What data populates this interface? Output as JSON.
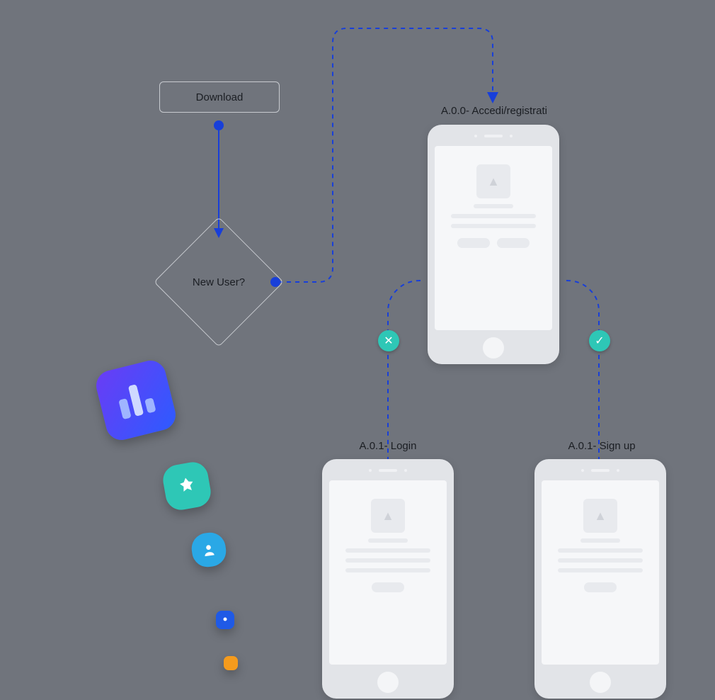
{
  "flow": {
    "download_label": "Download",
    "decision_label": "New User?"
  },
  "screens": {
    "accedi": {
      "label": "A.0.0- Accedi/registrati"
    },
    "login": {
      "label": "A.0.1- Login"
    },
    "signup": {
      "label": "A.0.1- Sign up"
    }
  },
  "badges": {
    "no": "✕",
    "yes": "✓"
  },
  "icons": {
    "thumb_glyph": "▲"
  }
}
